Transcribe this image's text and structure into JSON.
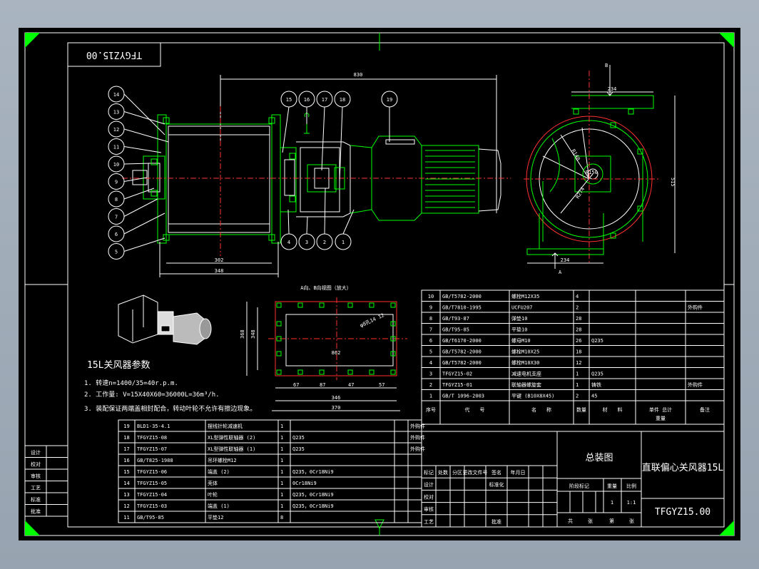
{
  "drawing": {
    "code_rotated": "TFGYZ15.00",
    "code_bottom": "TFGYZ15.00",
    "title_name": "直联偏心关风器15L",
    "assembly": "总装图"
  },
  "dims": {
    "overall": "830",
    "flange_w": "302",
    "flange_w2": "348",
    "top_w": "234",
    "base_w": "234",
    "height": "515",
    "r1": "R150",
    "r2": "R140",
    "r3": "R274",
    "section_B": "B",
    "section_A": "A",
    "hole": "φ8孔14 12",
    "span": "862",
    "d1": "67",
    "d2": "87",
    "d3": "47",
    "d4": "57",
    "w1": "346",
    "w2": "370",
    "side1": "368",
    "side2": "348"
  },
  "view_label": "A向、B向视图（放大）",
  "balloons_left": [
    "14",
    "13",
    "12",
    "11",
    "10",
    "9",
    "8",
    "7",
    "6",
    "5"
  ],
  "balloons_top": [
    "15",
    "16",
    "17",
    "18",
    "19"
  ],
  "balloons_bottom": [
    "4",
    "3",
    "2",
    "1"
  ],
  "params": {
    "title": "15L关风器参数",
    "lines": [
      "1. 转速n=1400/35=40r.p.m.",
      "2. 工作量: V=15X40X60=36000L=36m³/h.",
      "3. 装配保证两端盖相封配合，转动叶轮不允许有擦边现象。"
    ]
  },
  "bom_upper": {
    "rows": [
      [
        "10",
        "GB/T5782-2000",
        "螺栓M12X35",
        "4",
        "",
        "",
        ""
      ],
      [
        "9",
        "GB/T7810-1995",
        "UCFU207",
        "2",
        "",
        "",
        "外购件"
      ],
      [
        "8",
        "GB/T93-87",
        "弹垫10",
        "28",
        "",
        "",
        ""
      ],
      [
        "7",
        "GB/T95-85",
        "平垫10",
        "28",
        "",
        "",
        ""
      ],
      [
        "6",
        "GB/T6170-2000",
        "螺母M10",
        "26",
        "Q235",
        "",
        ""
      ],
      [
        "5",
        "GB/T5782-2000",
        "螺栓M10X25",
        "18",
        "",
        "",
        ""
      ],
      [
        "4",
        "GB/T5782-2000",
        "螺栓M10X30",
        "12",
        "",
        "",
        ""
      ],
      [
        "3",
        "TFGYZ15-02",
        "减速电机支座",
        "1",
        "Q235",
        "",
        ""
      ],
      [
        "2",
        "TFGYZ15-01",
        "联轴器螺旋套",
        "1",
        "铸铁",
        "",
        "外购件"
      ],
      [
        "1",
        "GB/T 1096-2003",
        "平键 (B10X8X45)",
        "2",
        "45",
        "",
        ""
      ]
    ],
    "headers": [
      "序号",
      "代　　号",
      "名　　称",
      "数量",
      "材　　料",
      "单件 总计\n重量",
      "备注"
    ]
  },
  "bom_lower": {
    "rows": [
      [
        "19",
        "BLD1-35-4.1",
        "摆线针轮减速机",
        "1",
        "",
        "",
        "外购件"
      ],
      [
        "18",
        "TFGYZ15-08",
        "XL型弹性联轴器 (2)",
        "1",
        "Q235",
        "",
        "外购件"
      ],
      [
        "17",
        "TFGYZ15-07",
        "XL型弹性联轴器 (1)",
        "1",
        "Q235",
        "",
        "外购件"
      ],
      [
        "16",
        "GB/T825-1988",
        "吊环螺栓M12",
        "1",
        "",
        "",
        ""
      ],
      [
        "15",
        "TFGYZ15-06",
        "端盖 (2)",
        "1",
        "Q235，0Cr18Ni9",
        "",
        ""
      ],
      [
        "14",
        "TFGYZ15-05",
        "壳体",
        "1",
        "0Cr18Ni9",
        "",
        ""
      ],
      [
        "13",
        "TFGYZ15-04",
        "叶轮",
        "1",
        "Q235，0Cr18Ni9",
        "",
        ""
      ],
      [
        "12",
        "TFGYZ15-03",
        "端盖 (1)",
        "1",
        "Q235，0Cr18Ni9",
        "",
        ""
      ],
      [
        "11",
        "GB/T95-85",
        "平垫12",
        "8",
        "",
        "",
        ""
      ]
    ]
  },
  "left_box": [
    "设计",
    "校对",
    "审核",
    "工艺",
    "标准",
    "批准"
  ],
  "title_block": {
    "sign_row": [
      "标记",
      "处数",
      "分区",
      "更改文件号",
      "签名",
      "年月日"
    ],
    "rows": [
      "设计",
      "校对",
      "审核",
      "工艺"
    ],
    "std": "标准化",
    "approve": "批准",
    "stage_headers": [
      "阶段标记",
      "重量",
      "比例"
    ],
    "qty": "1",
    "scale": "1:1",
    "sheet_label": [
      "共",
      "张",
      "第",
      "张"
    ]
  },
  "colors": {
    "line": "#ffffff",
    "green": "#00ff00",
    "red": "#ff3030",
    "paper": "#000000",
    "bg": "#a9b4c0"
  }
}
